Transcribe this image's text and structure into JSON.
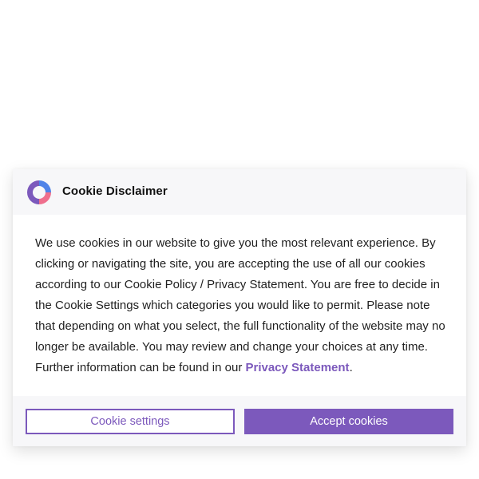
{
  "dialog": {
    "title": "Cookie Disclaimer",
    "logo_icon": "cookie-consent-ring-logo",
    "body_text": "We use cookies in our website to give you the most relevant experience. By clicking or navigating the site, you are accepting the use of all our cookies according to our Cookie Policy / Privacy Statement. You are free to decide in the Cookie Settings which categories you would like to permit. Please note that depending on what you select, the full functionality of the website may no longer be available. You may review and change your choices at any time. Further information can be found in our ",
    "privacy_link_label": "Privacy Statement",
    "body_suffix": ".",
    "settings_button_label": "Cookie settings",
    "accept_button_label": "Accept cookies"
  },
  "colors": {
    "accent": "#7c59bc",
    "logo_blue": "#4f83e8",
    "logo_pink": "#ef6f8d",
    "logo_purple": "#7c59bc",
    "header_bg": "#f7f7f9"
  }
}
